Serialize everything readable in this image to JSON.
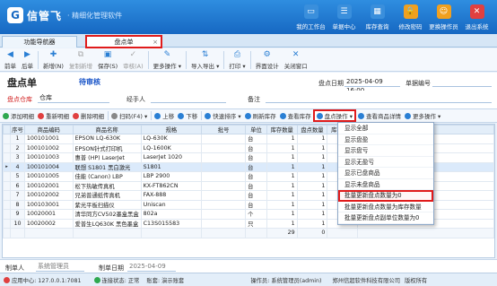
{
  "app": {
    "logo_mark": "G",
    "name": "信管飞",
    "subtitle": "· 精细化管理软件"
  },
  "top_nav": [
    {
      "label": "我的工作台",
      "icon": "monitor-icon",
      "glyph": "▭",
      "color": "#3a8fdc"
    },
    {
      "label": "单据中心",
      "icon": "list-icon",
      "glyph": "☰",
      "color": "#3a8fdc"
    },
    {
      "label": "库存查询",
      "icon": "grid-icon",
      "glyph": "▦",
      "color": "#3a8fdc"
    },
    {
      "label": "修改密码",
      "icon": "lock-icon",
      "glyph": "🔒",
      "color": "#f0a020"
    },
    {
      "label": "更换操作员",
      "icon": "user-icon",
      "glyph": "☺",
      "color": "#f0a020"
    },
    {
      "label": "退出系统",
      "icon": "exit-icon",
      "glyph": "✕",
      "color": "#e04040"
    }
  ],
  "tabs": [
    {
      "label": "功能导航器",
      "close": ""
    },
    {
      "label": "盘点单",
      "close": "×"
    }
  ],
  "toolbar": [
    {
      "label": "前单",
      "glyph": "◀",
      "disabled": false
    },
    {
      "label": "后单",
      "glyph": "▶",
      "disabled": false
    },
    {
      "label": "新增(N)",
      "glyph": "✚",
      "disabled": false
    },
    {
      "label": "复制新增",
      "glyph": "⧉",
      "disabled": true
    },
    {
      "label": "保存(S)",
      "glyph": "▣",
      "disabled": false
    },
    {
      "label": "审核(A)",
      "glyph": "✓",
      "disabled": true
    },
    {
      "label": "更多操作 ▾",
      "glyph": "✎",
      "disabled": false
    },
    {
      "label": "导入导出 ▾",
      "glyph": "⇅",
      "disabled": false
    },
    {
      "label": "打印 ▾",
      "glyph": "⎙",
      "disabled": false
    },
    {
      "label": "界面设计",
      "glyph": "⚙",
      "disabled": false
    },
    {
      "label": "关闭窗口",
      "glyph": "✕",
      "disabled": false
    }
  ],
  "header": {
    "title": "盘点单",
    "status": "待审核",
    "date_label": "盘点日期",
    "date_value": "2025-04-09 16:00",
    "number_label": "单据编号",
    "number_value": ""
  },
  "form": {
    "warehouse_label": "盘点仓库",
    "warehouse_value": "仓库",
    "handler_label": "经手人",
    "handler_value": "",
    "remark_label": "备注",
    "remark_value": ""
  },
  "grid_toolbar": [
    {
      "label": "添加明细",
      "color": "#2fa84f",
      "boxed": false
    },
    {
      "label": "重新明细",
      "color": "#e04040",
      "boxed": false
    },
    {
      "label": "删除明细",
      "color": "#e04040",
      "boxed": false
    },
    {
      "label": "扫码(F4) ▾",
      "color": "#888888",
      "boxed": false
    },
    {
      "label": "上移",
      "color": "#2a7fd4",
      "boxed": false
    },
    {
      "label": "下移",
      "color": "#2a7fd4",
      "boxed": false
    },
    {
      "label": "快速排序 ▾",
      "color": "#2a7fd4",
      "boxed": false
    },
    {
      "label": "刷新库存",
      "color": "#2a7fd4",
      "boxed": false
    },
    {
      "label": "查看库存",
      "color": "#2a7fd4",
      "boxed": false
    },
    {
      "label": "盘点操作 ▾",
      "color": "#2a7fd4",
      "boxed": true
    },
    {
      "label": "查看商品详情",
      "color": "#2a7fd4",
      "boxed": false
    },
    {
      "label": "更多操作 ▾",
      "color": "#2a7fd4",
      "boxed": false
    }
  ],
  "grid": {
    "columns": [
      "序号",
      "商品编码",
      "商品名称",
      "规格",
      "批号",
      "单位",
      "库存数量",
      "盘点数量",
      "库存成本"
    ],
    "rows": [
      {
        "no": "1",
        "code": "100101001",
        "name": "EPSON LQ-630K",
        "spec": "LQ-630K",
        "batch": "",
        "unit": "台",
        "stock": "1",
        "count": "1",
        "cost": "1200"
      },
      {
        "no": "2",
        "code": "100101002",
        "name": "EPSON针式打印机",
        "spec": "LQ-1600K",
        "batch": "",
        "unit": "台",
        "stock": "1",
        "count": "1",
        "cost": "0"
      },
      {
        "no": "3",
        "code": "100101003",
        "name": "惠普 (HP) LaserJet",
        "spec": "LaserJet 1020",
        "batch": "",
        "unit": "台",
        "stock": "1",
        "count": "1",
        "cost": "1680"
      },
      {
        "no": "4",
        "code": "100101004",
        "name": "联想 S1801 黑白激光",
        "spec": "S1801",
        "batch": "",
        "unit": "台",
        "stock": "1",
        "count": "1",
        "cost": ""
      },
      {
        "no": "5",
        "code": "100101005",
        "name": "佳能 (Canon) LBP",
        "spec": "LBP 2900",
        "batch": "",
        "unit": "台",
        "stock": "1",
        "count": "1",
        "cost": ""
      },
      {
        "no": "6",
        "code": "100102001",
        "name": "松下热敏传真机",
        "spec": "KX-FT862CN",
        "batch": "",
        "unit": "台",
        "stock": "1",
        "count": "1",
        "cost": ""
      },
      {
        "no": "7",
        "code": "100102002",
        "name": "兄弟普通纸传真机",
        "spec": "FAX-888",
        "batch": "",
        "unit": "台",
        "stock": "1",
        "count": "1",
        "cost": ""
      },
      {
        "no": "8",
        "code": "100103001",
        "name": "紫光平板扫描仪",
        "spec": "Uniscan",
        "batch": "",
        "unit": "台",
        "stock": "1",
        "count": "1",
        "cost": ""
      },
      {
        "no": "9",
        "code": "10020001",
        "name": "清华同方CV502墨盒黑盒",
        "spec": "802a",
        "batch": "",
        "unit": "个",
        "stock": "1",
        "count": "1",
        "cost": ""
      },
      {
        "no": "10",
        "code": "10020002",
        "name": "爱普生LQ630K 黑色墨盒",
        "spec": "C13S015583",
        "batch": "",
        "unit": "只",
        "stock": "1",
        "count": "1",
        "cost": ""
      }
    ],
    "current_row_index": 3,
    "current_marker": "▸",
    "sum_stock": "29",
    "sum_count": "0"
  },
  "dropdown": {
    "items": [
      {
        "label": "显示全部",
        "highlighted": false
      },
      {
        "label": "显示盘盈",
        "highlighted": false
      },
      {
        "label": "显示盘亏",
        "highlighted": false
      },
      {
        "label": "显示无盈亏",
        "highlighted": false
      },
      {
        "label": "显示已盘商品",
        "highlighted": false
      },
      {
        "label": "显示未盘商品",
        "highlighted": false
      },
      {
        "label": "批量更新盘点数量为0",
        "highlighted": true
      },
      {
        "label": "批量更新盘点数量为库存数量",
        "highlighted": false
      },
      {
        "label": "批量更新盘点副单位数量为0",
        "highlighted": false
      }
    ]
  },
  "footer": {
    "maker_label": "制单人",
    "maker_value": "系统管理员",
    "make_date_label": "制单日期",
    "make_date_value": "2025-04-09"
  },
  "statusbar": {
    "center": "应用中心: 127.0.0.1:7081",
    "connection": "连接状态: 正常",
    "account": "账套: 演示账套",
    "operator": "操作员: 系统管理员(admin)",
    "company": "郑州信超软件科技有限公司",
    "rights": "版权所有"
  },
  "colors": {
    "accent": "#1668c2",
    "highlight_border": "#e01b1b",
    "status_blue": "#1a55c8"
  }
}
